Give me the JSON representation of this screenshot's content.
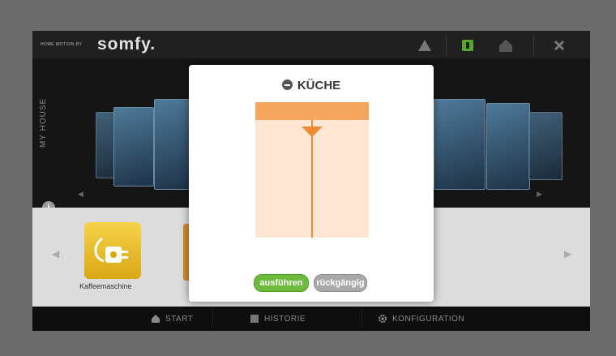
{
  "app": {
    "tagline": "HOME MOTION BY",
    "logo": "somfy."
  },
  "house": {
    "side_label": "MY HOUSE"
  },
  "devices": [
    {
      "label": "Kaffeemaschine"
    }
  ],
  "nav": {
    "start": "START",
    "history": "HISTORIE",
    "config": "KONFIGURATION"
  },
  "modal": {
    "title": "KÜCHE",
    "position_percent": 15,
    "execute_label": "ausführen",
    "undo_label": "rückgängig"
  },
  "colors": {
    "accent_orange": "#f08a30",
    "blind_bg": "#fde6d3",
    "execute_green": "#6dbb3c",
    "undo_gray": "#a9a9a9"
  }
}
